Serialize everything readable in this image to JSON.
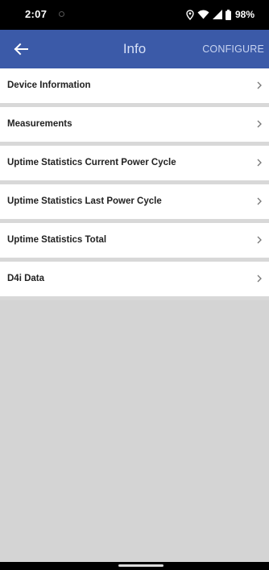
{
  "status_bar": {
    "time": "2:07",
    "battery": "98%",
    "icons": [
      "location-icon",
      "wifi-icon",
      "signal-icon",
      "battery-icon"
    ]
  },
  "app_bar": {
    "back_icon": "back-arrow-icon",
    "title": "Info",
    "action_label": "CONFIGURE"
  },
  "list": {
    "items": [
      {
        "label": "Device Information"
      },
      {
        "label": "Measurements"
      },
      {
        "label": "Uptime Statistics Current Power Cycle"
      },
      {
        "label": "Uptime Statistics Last Power Cycle"
      },
      {
        "label": "Uptime Statistics Total"
      },
      {
        "label": "D4i Data"
      }
    ]
  },
  "colors": {
    "app_bar": "#3b5aa8",
    "background": "#d4d4d4",
    "status_bar": "#000000"
  }
}
